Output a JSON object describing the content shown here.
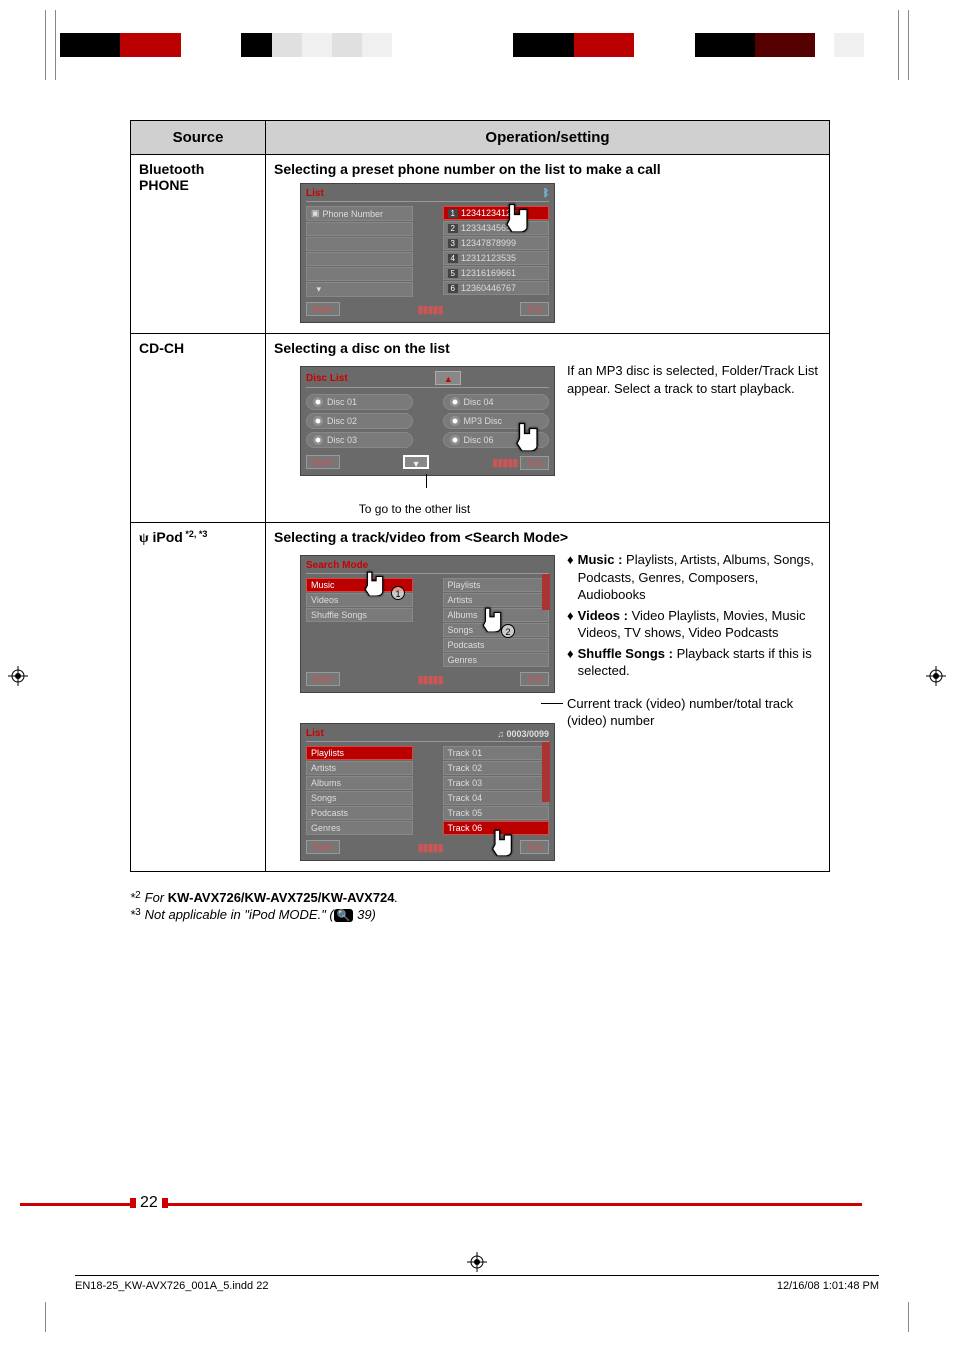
{
  "table": {
    "headers": {
      "source": "Source",
      "op": "Operation/setting"
    },
    "rows": {
      "bt": {
        "source": "Bluetooth PHONE",
        "heading": "Selecting a preset phone number on the list to make a call",
        "screen": {
          "title": "List",
          "left_label": "Phone Number",
          "items": [
            {
              "n": "1",
              "v": "12341234123"
            },
            {
              "n": "2",
              "v": "12334345656"
            },
            {
              "n": "3",
              "v": "12347878999"
            },
            {
              "n": "4",
              "v": "12312123535"
            },
            {
              "n": "5",
              "v": "12316169661"
            },
            {
              "n": "6",
              "v": "12360446767"
            }
          ],
          "back": "Back",
          "exit": "Exit"
        }
      },
      "cdch": {
        "source": "CD-CH",
        "heading": "Selecting a disc on the list",
        "screen": {
          "title": "Disc List",
          "left": [
            "Disc 01",
            "Disc 02",
            "Disc 03"
          ],
          "right": [
            "Disc 04",
            "MP3 Disc",
            "Disc 06"
          ],
          "back": "Back",
          "exit": "Exit"
        },
        "caption": "To go to the other list",
        "note": "If an MP3 disc is selected, Folder/Track List appear. Select a track to start playback."
      },
      "ipod": {
        "source_prefix": "iPod",
        "source_suffix": " *2, *3",
        "heading": "Selecting a track/video from <Search Mode>",
        "screen1": {
          "title": "Search Mode",
          "left": [
            "Music",
            "Videos",
            "Shuffle Songs"
          ],
          "right": [
            "Playlists",
            "Artists",
            "Albums",
            "Songs",
            "Podcasts",
            "Genres"
          ],
          "back": "Back",
          "exit": "Exit",
          "c1": "1",
          "c2": "2"
        },
        "screen2": {
          "title": "List",
          "counter": "0003/0099",
          "left": [
            "Playlists",
            "Artists",
            "Albums",
            "Songs",
            "Podcasts",
            "Genres"
          ],
          "right": [
            "Track 01",
            "Track 02",
            "Track 03",
            "Track 04",
            "Track 05",
            "Track 06"
          ],
          "back": "Back",
          "exit": "Exit"
        },
        "bullets": {
          "music_label": "Music :",
          "music_text": " Playlists, Artists, Albums, Songs, Podcasts, Genres, Composers, Audiobooks",
          "videos_label": "Videos :",
          "videos_text": " Video Playlists, Movies, Music Videos, TV shows, Video Podcasts",
          "shuffle_label": "Shuffle Songs :",
          "shuffle_text": " Playback starts if this is selected."
        },
        "counter_note": "Current track (video) number/total track (video) number"
      }
    }
  },
  "footnotes": {
    "f2_prefix": "For ",
    "f2_bold": "KW-AVX726/KW-AVX725/KW-AVX724",
    "f2_suffix": ".",
    "f3_a": "Not applicable in \"iPod MODE.\" (",
    "f3_b": " 39)"
  },
  "page_number": "22",
  "footer": {
    "file": "EN18-25_KW-AVX726_001A_5.indd   22",
    "date": "12/16/08   1:01:48 PM"
  }
}
